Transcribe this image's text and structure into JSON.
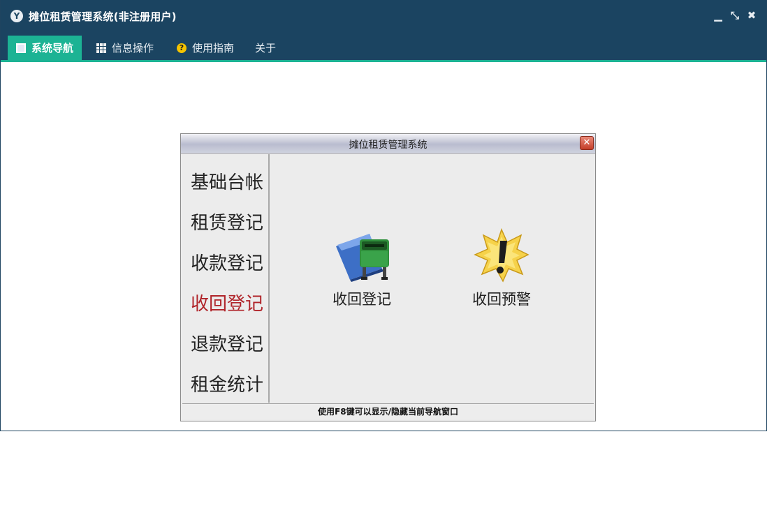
{
  "app": {
    "title": "摊位租赁管理系统(非注册用户)",
    "logo_letter": "Y",
    "controls": {
      "minimize": "▁",
      "restore": "⤡",
      "close": "✖"
    }
  },
  "menu": {
    "items": [
      {
        "label": "系统导航",
        "icon": "screen-icon",
        "active": true
      },
      {
        "label": "信息操作",
        "icon": "grid-icon",
        "active": false
      },
      {
        "label": "使用指南",
        "icon": "help-icon",
        "active": false
      },
      {
        "label": "关于",
        "icon": "",
        "active": false
      }
    ],
    "accent_color": "#1cb394",
    "bar_color": "#1b4461"
  },
  "dialog": {
    "title": "摊位租赁管理系统",
    "close_glyph": "✕",
    "nav": [
      {
        "label": "基础台帐",
        "active": false
      },
      {
        "label": "租赁登记",
        "active": false
      },
      {
        "label": "收款登记",
        "active": false
      },
      {
        "label": "收回登记",
        "active": true
      },
      {
        "label": "退款登记",
        "active": false
      },
      {
        "label": "租金统计",
        "active": false
      }
    ],
    "features": [
      {
        "label": "收回登记",
        "icon": "recycle-bin-icon"
      },
      {
        "label": "收回预警",
        "icon": "warning-burst-icon"
      }
    ],
    "status": "使用F8键可以显示/隐藏当前导航窗口",
    "active_color": "#b0242a"
  }
}
